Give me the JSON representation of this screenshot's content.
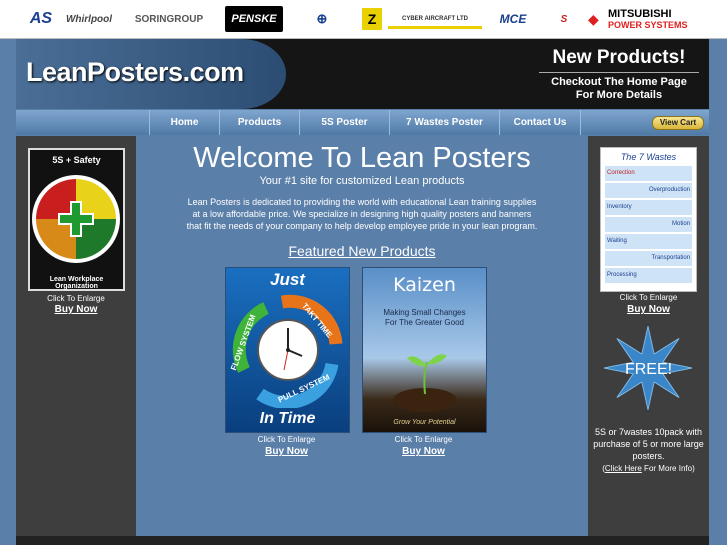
{
  "sponsors": [
    "AS",
    "Whirlpool",
    "SORINGROUP",
    "PENSKE",
    "⊕",
    "Z",
    "CYBER AIRCRAFT LTD",
    "MCE",
    "S",
    "MITSUBISHI",
    "POWER SYSTEMS"
  ],
  "banner": {
    "site_name": "LeanPosters.com",
    "promo_title": "New Products!",
    "promo_line1": "Checkout The Home Page",
    "promo_line2": "For More Details"
  },
  "nav": {
    "items": [
      "Home",
      "Products",
      "5S Poster",
      "7 Wastes Poster",
      "Contact Us"
    ],
    "cart_label": "View Cart"
  },
  "left": {
    "poster_title": "5S + Safety",
    "poster_caption": "Lean Workplace Organization",
    "enlarge": "Click To Enlarge",
    "buy": "Buy Now"
  },
  "main": {
    "welcome": "Welcome To Lean Posters",
    "tagline": "Your #1 site for customized Lean products",
    "description": "Lean Posters is dedicated to providing the world with educational Lean training supplies at a low affordable price. We specialize in designing high quality posters and banners that fit the needs of your company to help develop employee pride in your lean program.",
    "featured": "Featured New Products",
    "products": [
      {
        "top": "Just",
        "arrow1": "TAKT TIME",
        "arrow2": "FLOW SYSTEM",
        "arrow3": "PULL SYSTEM",
        "bottom": "In Time",
        "enlarge": "Click To Enlarge",
        "buy": "Buy Now"
      },
      {
        "title": "Kaizen",
        "subtitle": "Making Small Changes For The Greater Good",
        "footer": "Grow Your Potential",
        "enlarge": "Click To Enlarge",
        "buy": "Buy Now"
      }
    ]
  },
  "right": {
    "poster_title": "The 7 Wastes",
    "wastes": [
      "Correction",
      "Overproduction",
      "Inventory",
      "Motion",
      "Waiting",
      "Transportation",
      "Processing"
    ],
    "enlarge": "Click To Enlarge",
    "buy": "Buy Now",
    "free_label": "FREE!",
    "promo_text": "5S or 7wastes 10pack with purchase of 5 or more large posters.",
    "info_open": "(",
    "info_link": "Click Here",
    "info_close": " For More Info)"
  },
  "colors": {
    "page_bg": "#5a7fa8",
    "sidebar_bg": "#3e3e3e",
    "banner_bg": "#151515",
    "nav_bg": "#4f79a6",
    "star": "#3a86c8"
  }
}
